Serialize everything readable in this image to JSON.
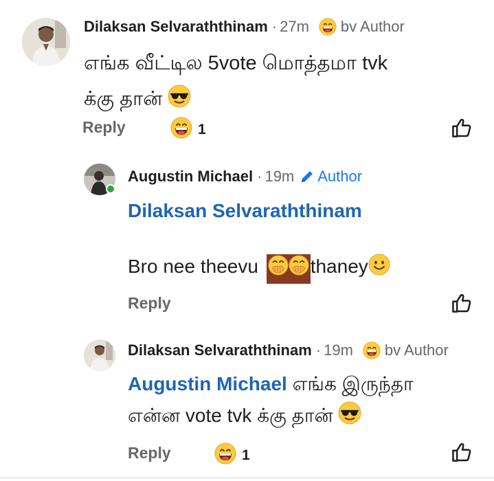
{
  "comments": [
    {
      "author": "Dilaksan Selvaraththinam",
      "separator": "·",
      "time": "27m",
      "badge": "bv Author",
      "text_line1": "எங்க வீட்டில 5vote மொத்தமா tvk",
      "text_line2": "க்கு தான்",
      "reply": "Reply",
      "reaction_count": "1"
    },
    {
      "author": "Augustin Michael",
      "separator": "·",
      "time": "19m",
      "badge": "Author",
      "mention": "Dilaksan Selvaraththinam",
      "text_before": "Bro nee theevu",
      "text_after": "thaney",
      "reply": "Reply"
    },
    {
      "author": "Dilaksan Selvaraththinam",
      "separator": "·",
      "time": "19m",
      "badge": "bv Author",
      "mention": "Augustin Michael",
      "text_line1_rest": "எங்க இருந்தா",
      "text_line2": "என்ன vote tvk க்கு தான்",
      "reply": "Reply",
      "reaction_count": "1"
    }
  ],
  "colors": {
    "mention": "#1d65b7",
    "author_badge": "#1877f2",
    "secondary_text": "#65676b",
    "online": "#31a24c"
  },
  "icons": [
    "grinning-face-icon",
    "sunglasses-emoji-icon",
    "grinning-squinting-face-icon",
    "hand-over-mouth-emoji-icon",
    "smiling-emoji-icon",
    "pencil-icon",
    "like-icon"
  ]
}
